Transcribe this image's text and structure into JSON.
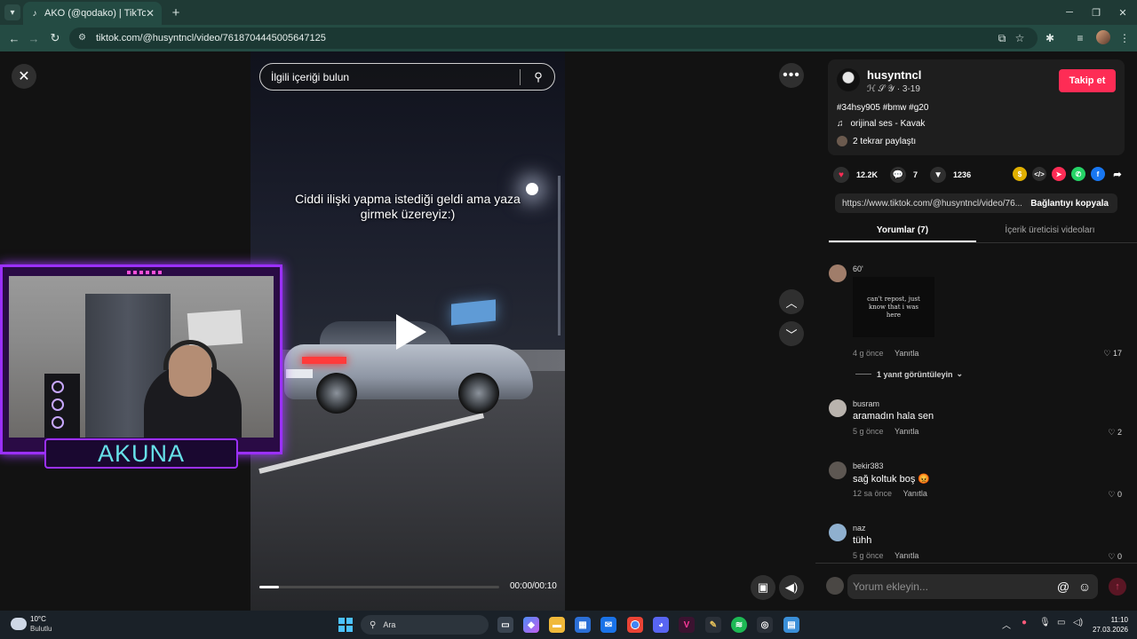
{
  "browser": {
    "tab_title": "AKO (@qodako) | TikTok",
    "url": "tiktok.com/@husyntncl/video/7618704445005647125"
  },
  "search": {
    "placeholder": "İlgili içeriği bulun"
  },
  "video": {
    "caption": "Ciddi ilişki yapma istediği geldi ama yaza girmek üzereyiz:)",
    "timecode": "00:00/00:10",
    "progress": 0.08
  },
  "overlay": {
    "name": "AKUNA"
  },
  "author": {
    "username": "husyntncl",
    "subtitle": "ℋ 𝒮 𝒴 · 3-19",
    "follow_label": "Takip et",
    "tags": "#34hsy905 #bmw #g20",
    "sound": "orijinal ses - Kavak",
    "repost": "2 tekrar paylaştı"
  },
  "stats": {
    "likes": "12.2K",
    "comments": "7",
    "saves": "1236"
  },
  "link": {
    "url": "https://www.tiktok.com/@husyntncl/video/76...",
    "copy_label": "Bağlantıyı kopyala"
  },
  "tabs": [
    {
      "label": "Yorumlar (7)",
      "active": true
    },
    {
      "label": "İçerik üreticisi videoları",
      "active": false
    }
  ],
  "comments": [
    {
      "user": "60'",
      "text": "",
      "image_text": "can't repost, just know that i was here",
      "time": "4 g önce",
      "reply": "Yanıtla",
      "likes": "17"
    },
    {
      "user": "busram",
      "text": "aramadın hala sen",
      "time": "5 g önce",
      "reply": "Yanıtla",
      "likes": "2"
    },
    {
      "user": "bekir383",
      "text": "sağ koltuk boş 😡",
      "time": "12 sa önce",
      "reply": "Yanıtla",
      "likes": "0"
    },
    {
      "user": "naz",
      "text": "tühh",
      "time": "5 g önce",
      "reply": "Yanıtla",
      "likes": "0"
    }
  ],
  "view_replies": "1 yanıt görüntüleyin",
  "comment_box": {
    "placeholder": "Yorum ekleyin..."
  },
  "taskbar": {
    "weather_temp": "10°C",
    "weather_cond": "Bulutlu",
    "search_label": "Ara",
    "time": "11:10",
    "date": "27.03.2026"
  },
  "colors": {
    "brand": "#fe2c55",
    "accent_overlay": "#9b30ff",
    "chrome": "#244b43"
  }
}
